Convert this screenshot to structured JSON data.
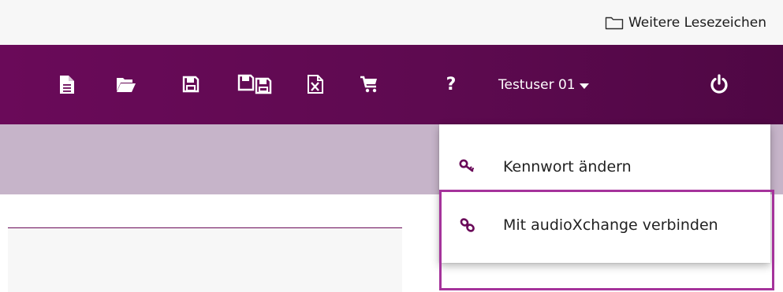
{
  "browser": {
    "bookmark_folder_label": "Weitere Lesezeichen"
  },
  "toolbar": {
    "icons": [
      "new-document-icon",
      "open-folder-icon",
      "save-icon",
      "save-all-icon",
      "excel-export-icon",
      "cart-icon",
      "help-icon"
    ],
    "help_label": "?",
    "user_name": "Testuser 01"
  },
  "user_menu": {
    "items": [
      {
        "label": "Kennwort ändern",
        "icon": "key-icon"
      },
      {
        "label": "Mit audioXchange verbinden",
        "icon": "link-icon",
        "highlighted": true
      }
    ]
  },
  "colors": {
    "toolbar": "#6a0a59",
    "subheader": "#c6b4c9",
    "menu_icon": "#6a0a59",
    "highlight": "#ffff33",
    "annotation_border": "#a5339b"
  }
}
